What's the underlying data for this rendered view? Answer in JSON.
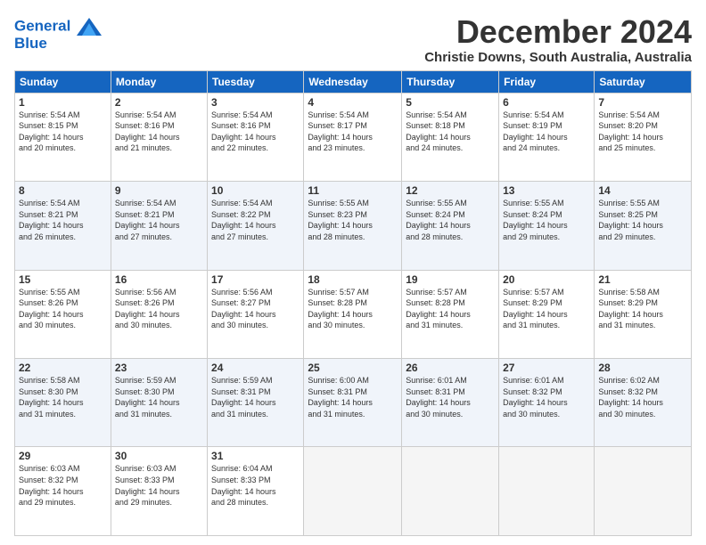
{
  "logo": {
    "line1": "General",
    "line2": "Blue"
  },
  "title": "December 2024",
  "location": "Christie Downs, South Australia, Australia",
  "weekdays": [
    "Sunday",
    "Monday",
    "Tuesday",
    "Wednesday",
    "Thursday",
    "Friday",
    "Saturday"
  ],
  "weeks": [
    [
      {
        "day": "1",
        "sunrise": "5:54 AM",
        "sunset": "8:15 PM",
        "daylight": "14 hours and 20 minutes."
      },
      {
        "day": "2",
        "sunrise": "5:54 AM",
        "sunset": "8:16 PM",
        "daylight": "14 hours and 21 minutes."
      },
      {
        "day": "3",
        "sunrise": "5:54 AM",
        "sunset": "8:16 PM",
        "daylight": "14 hours and 22 minutes."
      },
      {
        "day": "4",
        "sunrise": "5:54 AM",
        "sunset": "8:17 PM",
        "daylight": "14 hours and 23 minutes."
      },
      {
        "day": "5",
        "sunrise": "5:54 AM",
        "sunset": "8:18 PM",
        "daylight": "14 hours and 24 minutes."
      },
      {
        "day": "6",
        "sunrise": "5:54 AM",
        "sunset": "8:19 PM",
        "daylight": "14 hours and 24 minutes."
      },
      {
        "day": "7",
        "sunrise": "5:54 AM",
        "sunset": "8:20 PM",
        "daylight": "14 hours and 25 minutes."
      }
    ],
    [
      {
        "day": "8",
        "sunrise": "5:54 AM",
        "sunset": "8:21 PM",
        "daylight": "14 hours and 26 minutes."
      },
      {
        "day": "9",
        "sunrise": "5:54 AM",
        "sunset": "8:21 PM",
        "daylight": "14 hours and 27 minutes."
      },
      {
        "day": "10",
        "sunrise": "5:54 AM",
        "sunset": "8:22 PM",
        "daylight": "14 hours and 27 minutes."
      },
      {
        "day": "11",
        "sunrise": "5:55 AM",
        "sunset": "8:23 PM",
        "daylight": "14 hours and 28 minutes."
      },
      {
        "day": "12",
        "sunrise": "5:55 AM",
        "sunset": "8:24 PM",
        "daylight": "14 hours and 28 minutes."
      },
      {
        "day": "13",
        "sunrise": "5:55 AM",
        "sunset": "8:24 PM",
        "daylight": "14 hours and 29 minutes."
      },
      {
        "day": "14",
        "sunrise": "5:55 AM",
        "sunset": "8:25 PM",
        "daylight": "14 hours and 29 minutes."
      }
    ],
    [
      {
        "day": "15",
        "sunrise": "5:55 AM",
        "sunset": "8:26 PM",
        "daylight": "14 hours and 30 minutes."
      },
      {
        "day": "16",
        "sunrise": "5:56 AM",
        "sunset": "8:26 PM",
        "daylight": "14 hours and 30 minutes."
      },
      {
        "day": "17",
        "sunrise": "5:56 AM",
        "sunset": "8:27 PM",
        "daylight": "14 hours and 30 minutes."
      },
      {
        "day": "18",
        "sunrise": "5:57 AM",
        "sunset": "8:28 PM",
        "daylight": "14 hours and 30 minutes."
      },
      {
        "day": "19",
        "sunrise": "5:57 AM",
        "sunset": "8:28 PM",
        "daylight": "14 hours and 31 minutes."
      },
      {
        "day": "20",
        "sunrise": "5:57 AM",
        "sunset": "8:29 PM",
        "daylight": "14 hours and 31 minutes."
      },
      {
        "day": "21",
        "sunrise": "5:58 AM",
        "sunset": "8:29 PM",
        "daylight": "14 hours and 31 minutes."
      }
    ],
    [
      {
        "day": "22",
        "sunrise": "5:58 AM",
        "sunset": "8:30 PM",
        "daylight": "14 hours and 31 minutes."
      },
      {
        "day": "23",
        "sunrise": "5:59 AM",
        "sunset": "8:30 PM",
        "daylight": "14 hours and 31 minutes."
      },
      {
        "day": "24",
        "sunrise": "5:59 AM",
        "sunset": "8:31 PM",
        "daylight": "14 hours and 31 minutes."
      },
      {
        "day": "25",
        "sunrise": "6:00 AM",
        "sunset": "8:31 PM",
        "daylight": "14 hours and 31 minutes."
      },
      {
        "day": "26",
        "sunrise": "6:01 AM",
        "sunset": "8:31 PM",
        "daylight": "14 hours and 30 minutes."
      },
      {
        "day": "27",
        "sunrise": "6:01 AM",
        "sunset": "8:32 PM",
        "daylight": "14 hours and 30 minutes."
      },
      {
        "day": "28",
        "sunrise": "6:02 AM",
        "sunset": "8:32 PM",
        "daylight": "14 hours and 30 minutes."
      }
    ],
    [
      {
        "day": "29",
        "sunrise": "6:03 AM",
        "sunset": "8:32 PM",
        "daylight": "14 hours and 29 minutes."
      },
      {
        "day": "30",
        "sunrise": "6:03 AM",
        "sunset": "8:33 PM",
        "daylight": "14 hours and 29 minutes."
      },
      {
        "day": "31",
        "sunrise": "6:04 AM",
        "sunset": "8:33 PM",
        "daylight": "14 hours and 28 minutes."
      },
      null,
      null,
      null,
      null
    ]
  ],
  "labels": {
    "sunrise": "Sunrise:",
    "sunset": "Sunset:",
    "daylight": "Daylight:"
  }
}
